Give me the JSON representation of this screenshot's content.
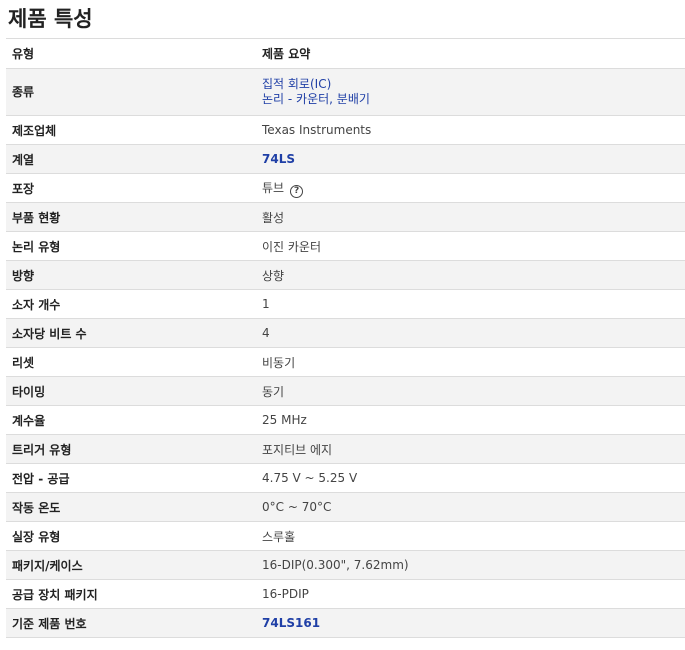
{
  "title": "제품 특성",
  "header": {
    "key": "유형",
    "value": "제품 요약"
  },
  "rows": [
    {
      "key": "종류",
      "values": [
        "집적 회로(IC)",
        "논리 - 카운터, 분배기"
      ]
    },
    {
      "key": "제조업체",
      "value": "Texas Instruments"
    },
    {
      "key": "계열",
      "value": "74LS"
    },
    {
      "key": "포장",
      "value": "튜브",
      "help_icon": "question-circle-icon",
      "help_glyph": "?"
    },
    {
      "key": "부품 현황",
      "value": "활성"
    },
    {
      "key": "논리 유형",
      "value": "이진 카운터"
    },
    {
      "key": "방향",
      "value": "상향"
    },
    {
      "key": "소자 개수",
      "value": "1"
    },
    {
      "key": "소자당 비트 수",
      "value": "4"
    },
    {
      "key": "리셋",
      "value": "비동기"
    },
    {
      "key": "타이밍",
      "value": "동기"
    },
    {
      "key": "계수율",
      "value": "25 MHz"
    },
    {
      "key": "트리거 유형",
      "value": "포지티브 에지"
    },
    {
      "key": "전압 - 공급",
      "value": "4.75 V ~ 5.25 V"
    },
    {
      "key": "작동 온도",
      "value": "0°C ~ 70°C"
    },
    {
      "key": "실장 유형",
      "value": "스루홀"
    },
    {
      "key": "패키지/케이스",
      "value": "16-DIP(0.300\", 7.62mm)"
    },
    {
      "key": "공급 장치 패키지",
      "value": "16-PDIP"
    },
    {
      "key": "기준 제품 번호",
      "value": "74LS161"
    }
  ],
  "colors": {
    "link": "#1f3fa6",
    "row_alt": "#f3f3f3",
    "border": "#dcdcdc"
  }
}
